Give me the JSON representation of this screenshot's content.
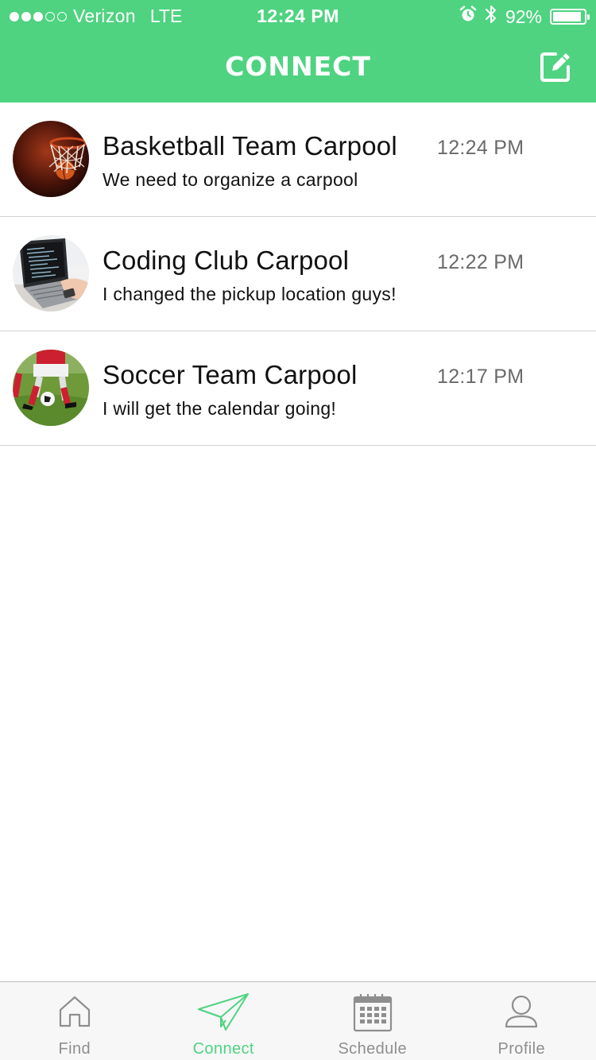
{
  "status_bar": {
    "carrier": "Verizon",
    "network": "LTE",
    "time": "12:24 PM",
    "battery": "92%",
    "battery_level": 0.92,
    "signal_bars": 3,
    "icons": [
      "signal-dots",
      "alarm-icon",
      "bluetooth-icon",
      "battery-icon"
    ]
  },
  "header": {
    "title": "CONNECT",
    "compose_icon": "compose-icon"
  },
  "colors": {
    "accent": "#4fd381",
    "text": "#111111",
    "time_text": "#6a6a6a",
    "tab_inactive": "#8e8e8e",
    "divider": "#d2d2d2"
  },
  "conversations": [
    {
      "title": "Basketball Team Carpool",
      "message": "We need to organize a carpool",
      "time": "12:24 PM",
      "avatar": "basketball-hoop-photo"
    },
    {
      "title": "Coding Club Carpool",
      "message": "I changed the pickup location guys!",
      "time": "12:22 PM",
      "avatar": "laptop-coding-photo"
    },
    {
      "title": "Soccer Team Carpool",
      "message": "I will get the calendar going!",
      "time": "12:17 PM",
      "avatar": "soccer-players-photo"
    }
  ],
  "tabs": [
    {
      "label": "Find",
      "icon": "home-icon",
      "active": false
    },
    {
      "label": "Connect",
      "icon": "paper-plane-icon",
      "active": true
    },
    {
      "label": "Schedule",
      "icon": "calendar-icon",
      "active": false
    },
    {
      "label": "Profile",
      "icon": "person-icon",
      "active": false
    }
  ]
}
